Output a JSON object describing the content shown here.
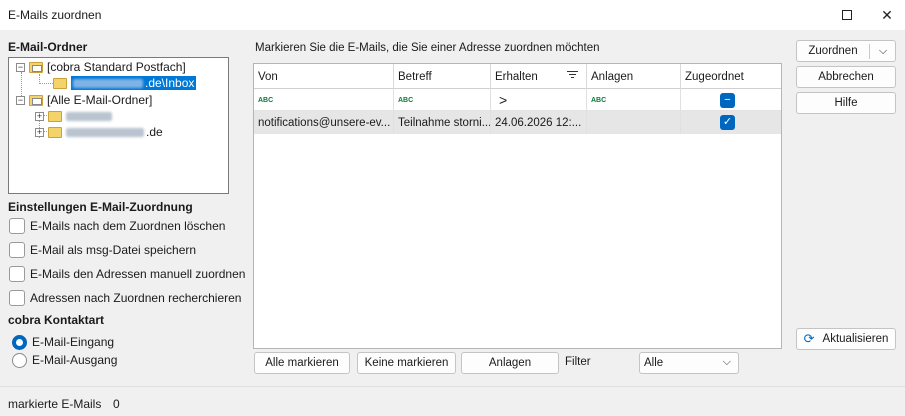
{
  "window": {
    "title": "E-Mails zuordnen"
  },
  "folders_section": {
    "heading": "E-Mail-Ordner",
    "tree": {
      "root1": "[cobra Standard Postfach]",
      "root1_child_suffix": ".de\\Inbox",
      "root2": "[Alle E-Mail-Ordner]",
      "root2_child2_suffix": ".de"
    }
  },
  "settings_section": {
    "heading": "Einstellungen E-Mail-Zuordnung",
    "options": [
      {
        "label": "E-Mails nach dem Zuordnen löschen"
      },
      {
        "label": "E-Mail als msg-Datei speichern"
      },
      {
        "label": "E-Mails den Adressen manuell zuordnen"
      },
      {
        "label": "Adressen nach Zuordnen recherchieren"
      }
    ]
  },
  "contact_type": {
    "heading": "cobra Kontaktart",
    "options": [
      {
        "label": "E-Mail-Eingang",
        "selected": true
      },
      {
        "label": "E-Mail-Ausgang",
        "selected": false
      }
    ]
  },
  "grid": {
    "instruction": "Markieren Sie die E-Mails, die Sie einer Adresse zuordnen möchten",
    "columns": [
      "Von",
      "Betreff",
      "Erhalten",
      "Anlagen",
      "Zugeordnet"
    ],
    "filter_row": {
      "von": "ABC",
      "betreff": "ABC",
      "erhalten": ">",
      "anlagen": "ABC"
    },
    "rows": [
      {
        "von": "notifications@unsere-ev...",
        "betreff": "Teilnahme storni...",
        "erhalten": "24.06.2026 12:...",
        "anlagen": "",
        "zugeordnet": true
      }
    ]
  },
  "bottom_buttons": {
    "mark_all": "Alle markieren",
    "mark_none": "Keine markieren",
    "attachments": "Anlagen",
    "filter_label": "Filter",
    "filter_value": "Alle"
  },
  "side_buttons": {
    "assign": "Zuordnen",
    "cancel": "Abbrechen",
    "help": "Hilfe",
    "refresh": "Aktualisieren"
  },
  "status": {
    "label": "markierte E-Mails",
    "count": "0"
  },
  "colors": {
    "accent": "#0067c0",
    "selection": "#0078d7"
  }
}
